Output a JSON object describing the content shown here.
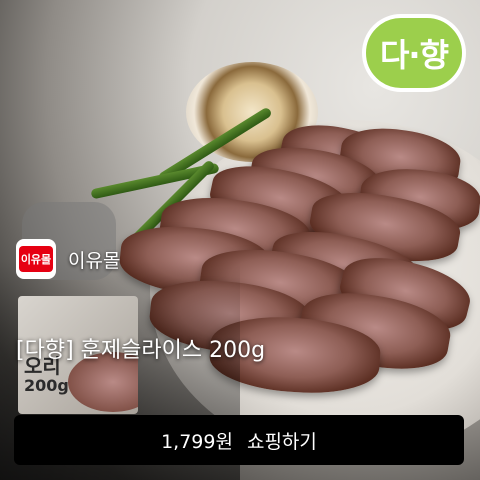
{
  "brand": {
    "logo_text": "다·향"
  },
  "package": {
    "label_line1": "오리",
    "label_line2": "200g",
    "tag_text": "200"
  },
  "shop": {
    "name": "이유몰",
    "avatar_text": "이유몰"
  },
  "product": {
    "title": "[다향] 훈제슬라이스 200g"
  },
  "cta": {
    "price": "1,799원",
    "label": "쇼핑하기"
  }
}
